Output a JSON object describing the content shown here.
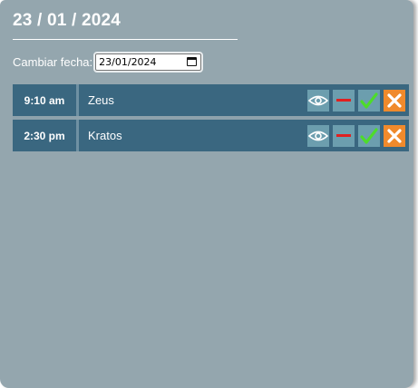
{
  "header": {
    "date_title": "23 / 01 / 2024"
  },
  "date_picker": {
    "label": "Cambiar fecha:",
    "value": "23/01/2024"
  },
  "appointments": [
    {
      "time": "9:10 am",
      "name": "Zeus"
    },
    {
      "time": "2:30 pm",
      "name": "Kratos"
    }
  ],
  "icons": {
    "view": "eye-icon",
    "remove": "minus-icon",
    "confirm": "check-icon",
    "cancel": "close-icon"
  },
  "colors": {
    "panel_bg": "#94a6ae",
    "row_bg": "#3a6780",
    "action_btn_bg": "#6c9eae",
    "cancel_btn_bg": "#f08a2c",
    "minus_red": "#e02020",
    "check_green": "#4ddc2a"
  }
}
